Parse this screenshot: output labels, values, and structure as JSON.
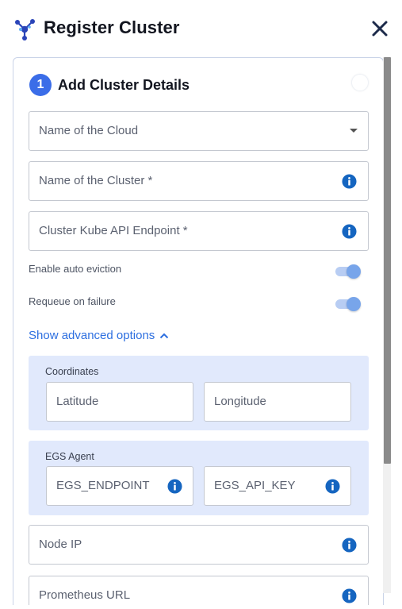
{
  "header": {
    "title": "Register Cluster",
    "logo_icon": "kubeslice-logo-icon",
    "close_icon": "close-icon"
  },
  "step": {
    "number": "1",
    "title": "Add Cluster Details"
  },
  "form": {
    "cloud_select": {
      "placeholder": "Name of the Cloud",
      "icon": "chevron-down-icon"
    },
    "cluster_name": {
      "label": "Name of the Cluster *",
      "icon": "info-icon"
    },
    "api_endpoint": {
      "label": "Cluster Kube API Endpoint *",
      "icon": "info-icon"
    },
    "auto_eviction": {
      "label": "Enable auto eviction",
      "enabled": true
    },
    "requeue": {
      "label": "Requeue on failure",
      "enabled": true
    },
    "advanced_link": "Show advanced options",
    "coordinates": {
      "title": "Coordinates",
      "latitude": "Latitude",
      "longitude": "Longitude"
    },
    "egs_agent": {
      "title": "EGS Agent",
      "endpoint": "EGS_ENDPOINT",
      "api_key": "EGS_API_KEY"
    },
    "node_ip": {
      "label": "Node IP"
    },
    "prometheus_url": {
      "label": "Prometheus URL"
    }
  },
  "colors": {
    "accent": "#3b6de8",
    "link": "#2d6fe0",
    "info": "#1565c0",
    "group_bg": "#e1e9fc"
  }
}
